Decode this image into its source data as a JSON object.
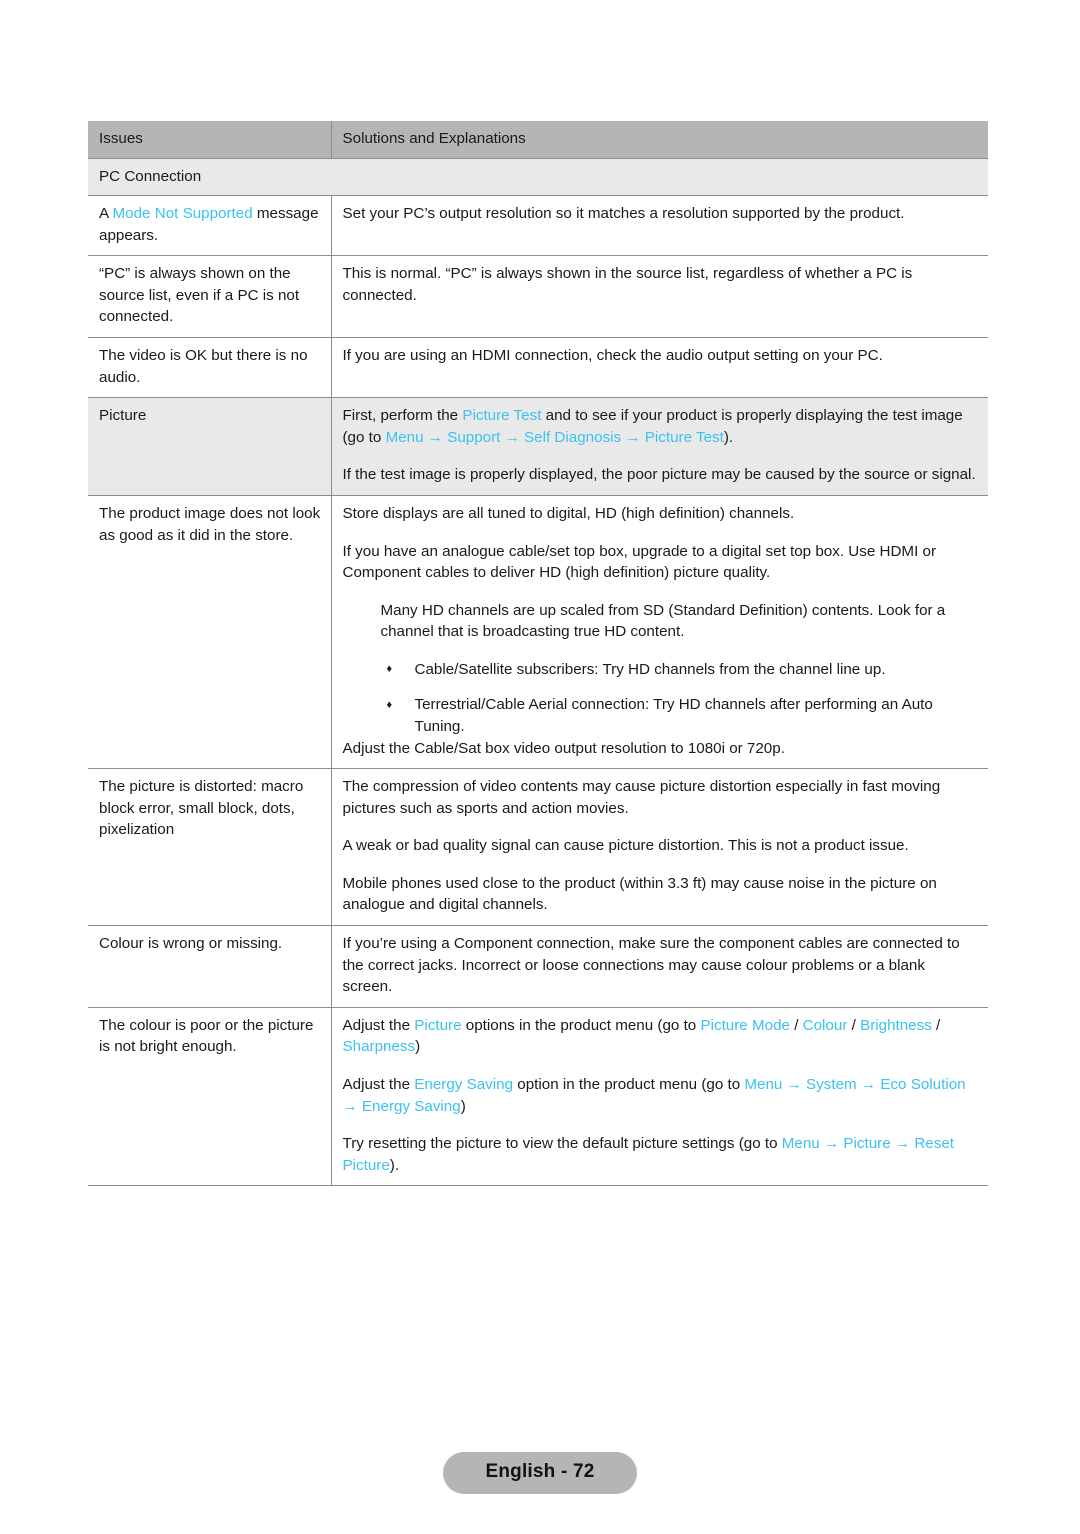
{
  "document": {
    "table": {
      "columns": [
        "Issues",
        "Solutions and Explanations"
      ],
      "section_header": "PC Connection",
      "rows": [
        {
          "issue_pre": "A ",
          "issue_link": "Mode Not Supported",
          "issue_post": " message appears.",
          "solution": "Set your PC’s output resolution so it matches a resolution supported by the product."
        },
        {
          "issue": "“PC” is always shown on the source list, even if a PC is not connected.",
          "solution": "This is normal. “PC” is always shown in the source list, regardless of whether a PC is connected."
        },
        {
          "issue": "The video is OK but there is no audio.",
          "solution": "If you are using an HDMI connection, check the audio output setting on your PC."
        },
        {
          "issue": "Picture",
          "sol_p1_a": "First, perform the ",
          "sol_p1_link1": "Picture Test",
          "sol_p1_b": " and to see if your product is properly displaying the test image (go to ",
          "sol_p1_m1": "Menu",
          "sol_p1_m2": "Support",
          "sol_p1_m3": "Self Diagnosis",
          "sol_p1_m4": "Picture Test",
          "sol_p1_c": ").",
          "sol_p2": "If the test image is properly displayed, the poor picture may be caused by the source or signal."
        },
        {
          "issue": "The product image does not look as good as it did in the store.",
          "sol_p1": "Store displays are all tuned to digital, HD (high definition) channels.",
          "sol_p2": "If you have an analogue cable/set top box, upgrade to a digital set top box. Use HDMI or Component cables to deliver HD (high definition) picture quality.",
          "sol_p3": "Many HD channels are up scaled from SD (Standard Definition) contents. Look for a channel that is broadcasting true HD content.",
          "bullets": [
            "Cable/Satellite subscribers: Try HD channels from the channel line up.",
            "Terrestrial/Cable Aerial connection: Try HD channels after performing an Auto Tuning."
          ],
          "sol_p4": "Adjust the Cable/Sat box video output resolution to 1080i or 720p."
        },
        {
          "issue": "The picture is distorted: macro block error, small block, dots, pixelization",
          "sol_p1": "The compression of video contents may cause picture distortion especially in fast moving pictures such as sports and action movies.",
          "sol_p2": "A weak or bad quality signal can cause picture distortion. This is not a product issue.",
          "sol_p3": "Mobile phones used close to the product (within 3.3 ft) may cause noise in the picture on analogue and digital channels."
        },
        {
          "issue": "Colour is wrong or missing.",
          "solution": "If you’re using a Component connection, make sure the component cables are connected to the correct jacks. Incorrect or loose connections may cause colour problems or a blank screen."
        },
        {
          "issue": "The colour is poor or the picture is not bright enough.",
          "sol_p1_a": "Adjust the ",
          "sol_p1_link1": "Picture",
          "sol_p1_b": " options in the product menu (go to ",
          "sol_p1_l2": "Picture Mode",
          "sol_p1_sep1": " / ",
          "sol_p1_l3": "Colour",
          "sol_p1_sep2": " / ",
          "sol_p1_l4": "Brightness",
          "sol_p1_sep3": " / ",
          "sol_p1_l5": "Sharpness",
          "sol_p1_c": ")",
          "sol_p2_a": "Adjust the ",
          "sol_p2_link1": "Energy Saving",
          "sol_p2_b": " option in the product menu (go to ",
          "sol_p2_m1": "Menu",
          "sol_p2_m2": "System",
          "sol_p2_m3": "Eco Solution",
          "sol_p2_m4": "Energy Saving",
          "sol_p2_c": ")",
          "sol_p3_a": "Try resetting the picture to view the default picture settings (go to ",
          "sol_p3_m1": "Menu",
          "sol_p3_m2": "Picture",
          "sol_p3_m3": "Reset Picture",
          "sol_p3_c": ")."
        }
      ]
    },
    "footer": {
      "page_label": "English - 72"
    },
    "symbols": {
      "arrow": "→",
      "bullet": "♦"
    },
    "colors": {
      "link": "#3cc2ef",
      "header_bg": "#b5b5b5",
      "shaded_bg": "#e9e9e9",
      "rule": "#8c8c8c"
    }
  }
}
